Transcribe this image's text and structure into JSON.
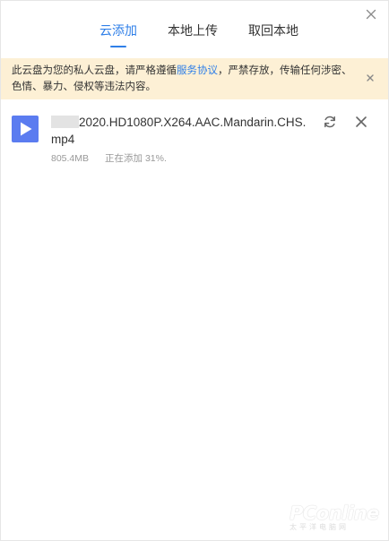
{
  "tabs": [
    {
      "label": "云添加",
      "active": true
    },
    {
      "label": "本地上传",
      "active": false
    },
    {
      "label": "取回本地",
      "active": false
    }
  ],
  "notice": {
    "text_before": "此云盘为您的私人云盘，请严格遵循",
    "link_text": "服务协议",
    "text_after": "，严禁存放，传输任何涉密、色情、暴力、侵权等违法内容。"
  },
  "file": {
    "name": "2020.HD1080P.X264.AAC.Mandarin.CHS.mp4",
    "size": "805.4MB",
    "status": "正在添加 31%."
  },
  "watermark": {
    "brand": "PConline",
    "sub": "太平洋电脑网"
  },
  "colors": {
    "accent": "#2f7fe8",
    "notice_bg": "#fdf0d5",
    "file_icon": "#5b7cf0"
  },
  "icons": {
    "dialog_close": "close-icon",
    "notice_close": "close-icon",
    "file_type": "video-play-icon",
    "retry": "refresh-icon",
    "cancel": "close-icon"
  }
}
